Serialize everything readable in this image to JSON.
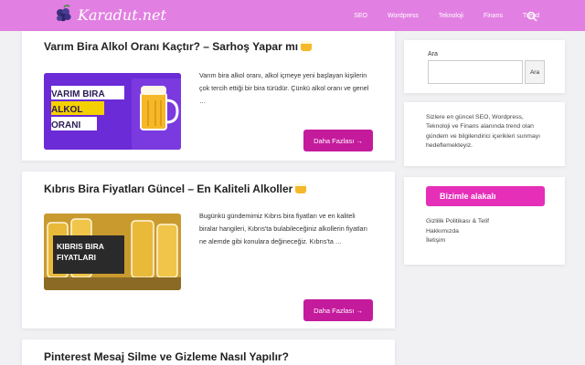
{
  "header": {
    "logo_text": "Karadut.net",
    "nav": [
      {
        "label": "SEO"
      },
      {
        "label": "Wordpress"
      },
      {
        "label": "Teknoloji"
      },
      {
        "label": "Finans"
      },
      {
        "label": "Trend"
      }
    ],
    "bg_color": "#e27fe2"
  },
  "posts": [
    {
      "title": "Varım Bira Alkol Oranı Kaçtır? – Sarhoş Yapar mı",
      "thumb_text": [
        "VARIM BIRA",
        "ALKOL",
        "ORANI"
      ],
      "excerpt": "Varım bira alkol oranı, alkol içmeye yeni başlayan kişilerin çok tercih ettiği bir bira türüdür. Çünkü alkol oranı ve genel …",
      "button": "Daha Fazlası →"
    },
    {
      "title": "Kıbrıs Bira Fiyatları Güncel – En Kaliteli Alkoller",
      "thumb_text": [
        "KIBRIS BIRA",
        "FIYATLARI"
      ],
      "excerpt": "Bugünkü gündemimiz Kıbrıs bira fiyatları ve en kaliteli biralar hangileri, Kıbrıs'ta bulabileceğiniz alkollerin fiyatları ne alemde gibi konulara değineceğiz. Kıbrıs'ta …",
      "button": "Daha Fazlası →"
    },
    {
      "title": "Pinterest Mesaj Silme ve Gizleme Nasıl Yapılır?"
    }
  ],
  "sidebar": {
    "search": {
      "label": "Ara",
      "placeholder": "",
      "button": "Ara"
    },
    "about": "Sizlere en güncel SEO, Wordpress, Teknoloji ve Finans alanında trend olan gündem ve bilgilendirici içerikleri sunmayı hedeflemekteyiz.",
    "links_heading": "Bizimle alakalı",
    "links": [
      "Gizlilik Politikası & Telif",
      "Hakkımızda",
      "İletişim"
    ]
  },
  "colors": {
    "accent": "#c41b9d",
    "heading_pink": "#e62fb8"
  },
  "icons": {
    "search": "search-icon",
    "logo": "blackberry-logo-icon",
    "beer": "beer-mug-icon"
  }
}
